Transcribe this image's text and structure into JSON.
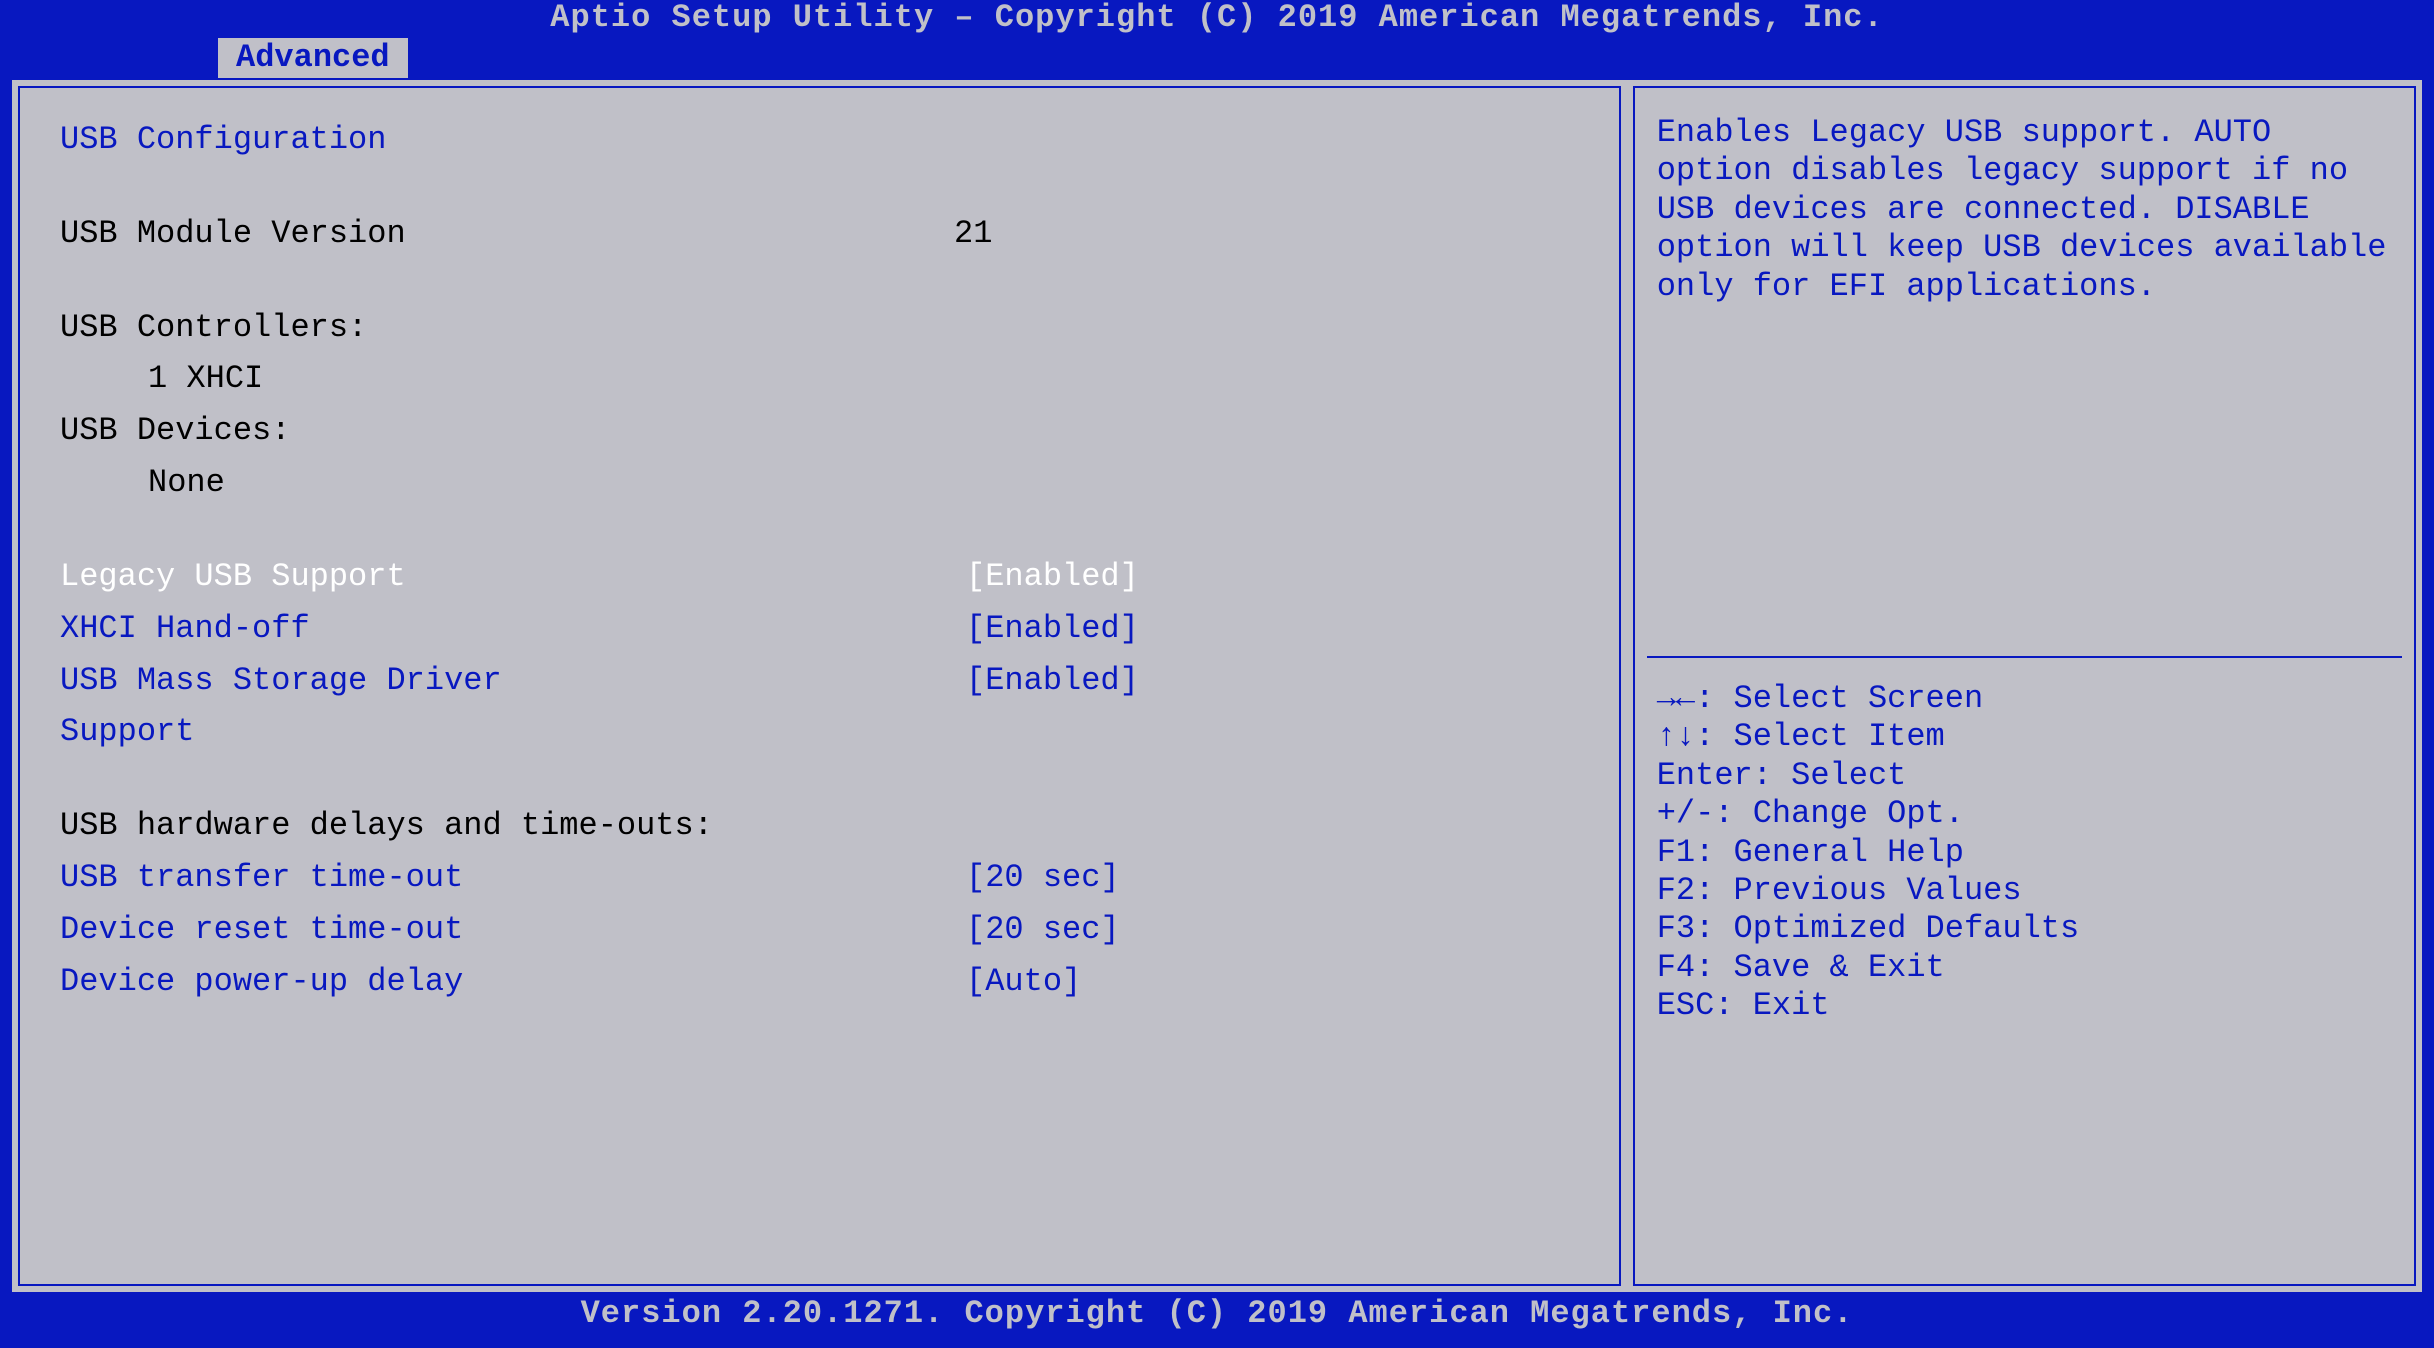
{
  "header": {
    "title": "Aptio Setup Utility – Copyright (C) 2019 American Megatrends, Inc."
  },
  "tab": {
    "label": "Advanced"
  },
  "main": {
    "section_title": "USB Configuration",
    "module_version_label": "USB Module Version",
    "module_version_value": "21",
    "controllers_label": "USB Controllers:",
    "controllers_value": "1 XHCI",
    "devices_label": "USB Devices:",
    "devices_value": "None",
    "settings": [
      {
        "label": "Legacy USB Support",
        "value": "[Enabled]",
        "selected": true
      },
      {
        "label": "XHCI Hand-off",
        "value": "[Enabled]",
        "selected": false
      },
      {
        "label": "USB Mass Storage Driver Support",
        "value": "[Enabled]",
        "selected": false
      }
    ],
    "delays_title": "USB hardware delays and time-outs:",
    "delays": [
      {
        "label": "USB transfer time-out",
        "value": "[20 sec]"
      },
      {
        "label": "Device reset time-out",
        "value": "[20 sec]"
      },
      {
        "label": "Device power-up delay",
        "value": "[Auto]"
      }
    ]
  },
  "help": {
    "text": "Enables Legacy USB support. AUTO option disables legacy support if no USB devices are connected. DISABLE option will keep USB devices available only for EFI applications."
  },
  "keys": {
    "k0": "→←: Select Screen",
    "k1": "↑↓: Select Item",
    "k2": "Enter: Select",
    "k3": "+/-: Change Opt.",
    "k4": "F1: General Help",
    "k5": "F2: Previous Values",
    "k6": "F3: Optimized Defaults",
    "k7": "F4: Save & Exit",
    "k8": "ESC: Exit"
  },
  "footer": {
    "version": "Version 2.20.1271. Copyright (C) 2019 American Megatrends, Inc."
  }
}
